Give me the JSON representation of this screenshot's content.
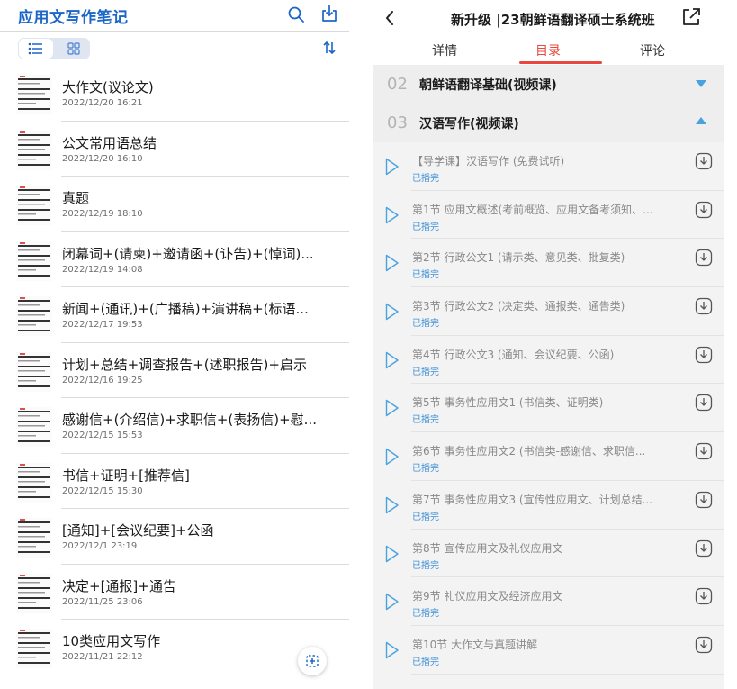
{
  "left": {
    "title": "应用文写作笔记",
    "notes": [
      {
        "title": "大作文(议论文)",
        "date": "2022/12/20 16:21"
      },
      {
        "title": "公文常用语总结",
        "date": "2022/12/20 16:10"
      },
      {
        "title": "真题",
        "date": "2022/12/19 18:10"
      },
      {
        "title": "闭幕词+(请柬)+邀请函+(讣告)+(悼词)...",
        "date": "2022/12/19 14:08"
      },
      {
        "title": "新闻+(通讯)+(广播稿)+演讲稿+(标语...",
        "date": "2022/12/17 19:53"
      },
      {
        "title": "计划+总结+调查报告+(述职报告)+启示",
        "date": "2022/12/16 19:25"
      },
      {
        "title": "感谢信+(介绍信)+求职信+(表扬信)+慰...",
        "date": "2022/12/15 15:53"
      },
      {
        "title": "书信+证明+[推荐信]",
        "date": "2022/12/15 15:30"
      },
      {
        "title": "[通知]+[会议纪要]+公函",
        "date": "2022/12/1 23:19"
      },
      {
        "title": "决定+[通报]+通告",
        "date": "2022/11/25 23:06"
      },
      {
        "title": "10类应用文写作",
        "date": "2022/11/21 22:12"
      }
    ]
  },
  "right": {
    "title": "新升级 |23朝鲜语翻译硕士系统班",
    "tabs": [
      {
        "label": "详情",
        "active": false
      },
      {
        "label": "目录",
        "active": true
      },
      {
        "label": "评论",
        "active": false
      }
    ],
    "sections": [
      {
        "num": "02",
        "title": "朝鲜语翻译基础(视频课)",
        "expanded": false
      },
      {
        "num": "03",
        "title": "汉语写作(视频课)",
        "expanded": true
      }
    ],
    "lessons": [
      {
        "title": "【导学课】汉语写作 (免费试听)",
        "status": "已播完"
      },
      {
        "title": "第1节 应用文概述(考前概览、应用文备考须知、...",
        "status": "已播完"
      },
      {
        "title": "第2节 行政公文1 (请示类、意见类、批复类)",
        "status": "已播完"
      },
      {
        "title": "第3节 行政公文2 (决定类、通报类、通告类)",
        "status": "已播完"
      },
      {
        "title": "第4节 行政公文3 (通知、会议纪要、公函)",
        "status": "已播完"
      },
      {
        "title": "第5节 事务性应用文1 (书信类、证明类)",
        "status": "已播完"
      },
      {
        "title": "第6节 事务性应用文2 (书信类-感谢信、求职信...",
        "status": "已播完"
      },
      {
        "title": "第7节 事务性应用文3 (宣传性应用文、计划总结...",
        "status": "已播完"
      },
      {
        "title": "第8节 宣传应用文及礼仪应用文",
        "status": "已播完"
      },
      {
        "title": "第9节 礼仪应用文及经济应用文",
        "status": "已播完"
      },
      {
        "title": "第10节 大作文与真题讲解",
        "status": "已播完"
      }
    ]
  },
  "colors": {
    "accent_blue": "#1c66c7",
    "tab_red": "#e8483f",
    "status_blue": "#3c8fd6",
    "caret_blue": "#4aa3df"
  }
}
